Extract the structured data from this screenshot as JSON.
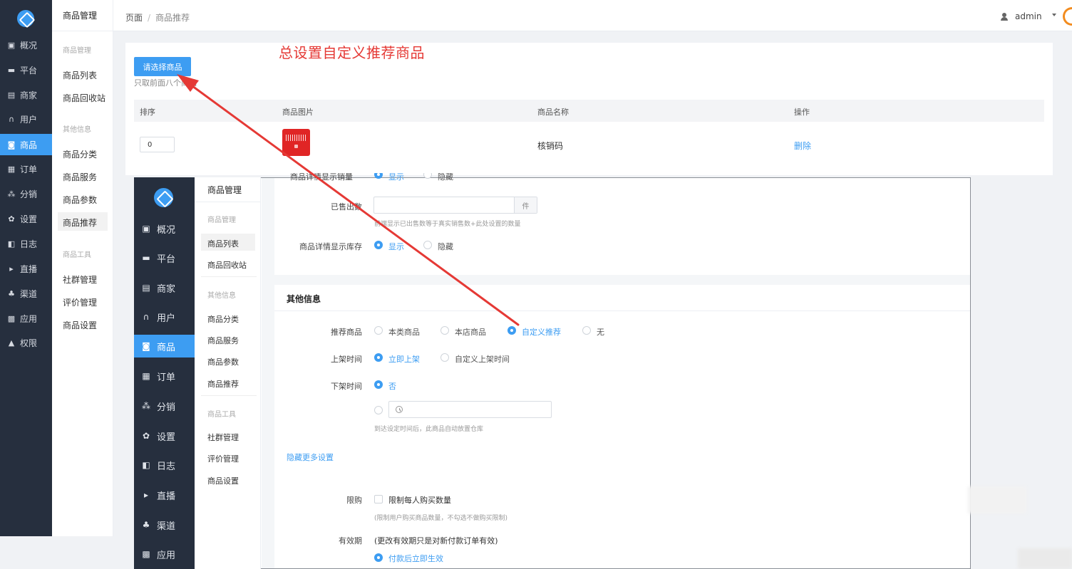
{
  "annotation": "总设置自定义推荐商品",
  "back": {
    "sidebar": [
      "概况",
      "平台",
      "商家",
      "用户",
      "商品",
      "订单",
      "分销",
      "设置",
      "日志",
      "直播",
      "渠道",
      "应用",
      "权限"
    ],
    "sub_title": "商品管理",
    "sub_groups": [
      "商品管理",
      "其他信息",
      "商品工具"
    ],
    "sub_items": [
      "商品列表",
      "商品回收站",
      "商品分类",
      "商品服务",
      "商品参数",
      "商品推荐",
      "社群管理",
      "评价管理",
      "商品设置"
    ],
    "breadcrumb": {
      "root": "页面",
      "sep": "/",
      "current": "商品推荐"
    },
    "user": "admin",
    "choose_button": "请选择商品",
    "hint": "只取前面八个商品",
    "table": {
      "headers": [
        "排序",
        "商品图片",
        "商品名称",
        "操作"
      ],
      "rows": [
        {
          "sort": "0",
          "name": "核销码",
          "action": "删除"
        }
      ]
    }
  },
  "front": {
    "sidebar": [
      "概况",
      "平台",
      "商家",
      "用户",
      "商品",
      "订单",
      "分销",
      "设置",
      "日志",
      "直播",
      "渠道",
      "应用"
    ],
    "sub_title": "商品管理",
    "sub_groups": [
      "商品管理",
      "其他信息",
      "商品工具"
    ],
    "sub_items": [
      "商品列表",
      "商品回收站",
      "商品分类",
      "商品服务",
      "商品参数",
      "商品推荐",
      "社群管理",
      "评价管理",
      "商品设置"
    ],
    "partial_row": {
      "label": "商品详情显示销量",
      "options": [
        "显示",
        "隐藏"
      ]
    },
    "sold": {
      "label": "已售出数",
      "addon": "件",
      "help": "前端显示已出售数等于真实销售数+此处设置的数量"
    },
    "stock": {
      "label": "商品详情显示库存",
      "options": [
        "显示",
        "隐藏"
      ]
    },
    "other_title": "其他信息",
    "recommend": {
      "label": "推荐商品",
      "options": [
        "本类商品",
        "本店商品",
        "自定义推荐",
        "无"
      ]
    },
    "shelf_on": {
      "label": "上架时间",
      "options": [
        "立即上架",
        "自定义上架时间"
      ]
    },
    "shelf_off": {
      "label": "下架时间",
      "option": "否",
      "help": "到达设定时间后，此商品自动放置仓库"
    },
    "more_link": "隐藏更多设置",
    "limit": {
      "label": "限购",
      "checkbox": "限制每人购买数量",
      "help": "(限制用户购买商品数量，不勾选不做购买限制)"
    },
    "validity": {
      "label": "有效期",
      "note": "(更改有效期只是对新付款订单有效)",
      "option": "付款后立即生效"
    }
  },
  "colors": {
    "accent": "#3d9df2",
    "sidebar": "#262f3e",
    "annotation": "#e53935"
  }
}
